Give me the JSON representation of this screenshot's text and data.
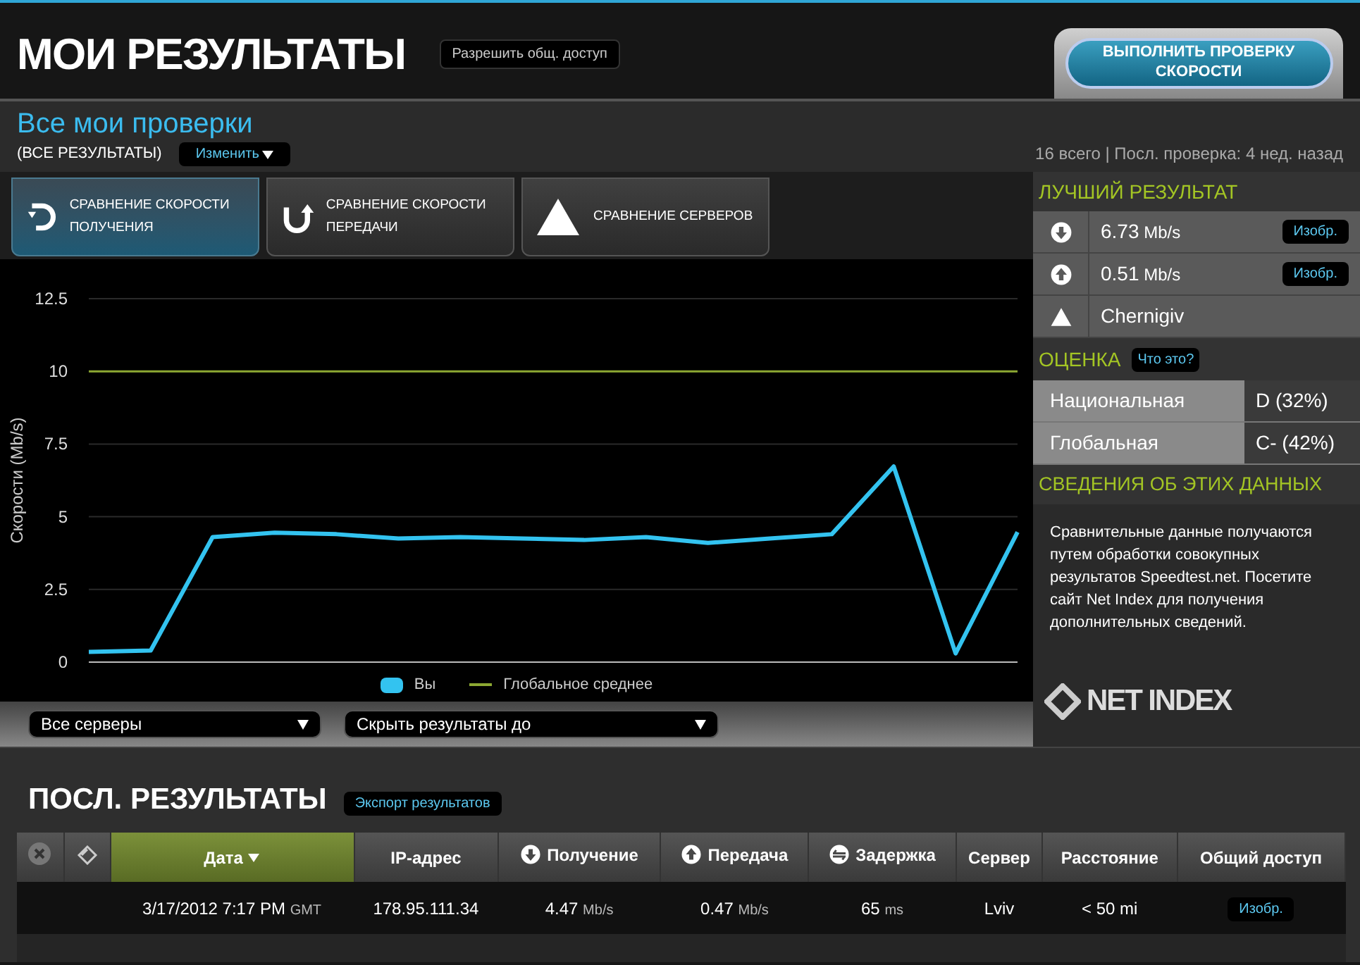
{
  "header": {
    "title": "МОИ РЕЗУЛЬТАТЫ",
    "share_button": "Разрешить общ. доступ",
    "run_test_button": "ВЫПОЛНИТЬ ПРОВЕРКУ СКОРОСТИ"
  },
  "overview": {
    "title": "Все мои проверки",
    "filter_label": "(ВСЕ РЕЗУЛЬТАТЫ)",
    "change_button": "Изменить",
    "summary": "16 всего | Посл. проверка: 4 нед. назад",
    "tabs": [
      {
        "kind": "download",
        "label": "СРАВНЕНИЕ СКОРОСТИ ПОЛУЧЕНИЯ",
        "selected": true
      },
      {
        "kind": "upload",
        "label": "СРАВНЕНИЕ СКОРОСТИ ПЕРЕДАЧИ",
        "selected": false
      },
      {
        "kind": "server",
        "label": "СРАВНЕНИЕ СЕРВЕРОВ",
        "selected": false
      }
    ],
    "chart_data": {
      "type": "line",
      "ylabel": "Скорости (Mb/s)",
      "grid": true,
      "ylim": [
        0,
        12.5
      ],
      "yticks": [
        0,
        2.5,
        5,
        7.5,
        10,
        12.5
      ],
      "series": [
        {
          "name": "Вы",
          "color": "#33c3f0",
          "values": [
            0.35,
            0.4,
            4.3,
            4.45,
            4.4,
            4.25,
            4.3,
            4.25,
            4.2,
            4.3,
            4.1,
            4.25,
            4.4,
            6.73,
            0.3,
            4.47
          ]
        },
        {
          "name": "Глобальное среднее",
          "color": "#8ca832",
          "values": [
            10,
            10,
            10,
            10,
            10,
            10,
            10,
            10,
            10,
            10,
            10,
            10,
            10,
            10,
            10,
            10
          ]
        }
      ]
    },
    "server_select": "Все серверы",
    "hide_select": "Скрыть результаты до"
  },
  "best": {
    "title": "ЛУЧШИЙ РЕЗУЛЬТАТ",
    "rows": [
      {
        "kind": "download",
        "value": "6.73",
        "unit": "Mb/s",
        "button": "Изобр."
      },
      {
        "kind": "upload",
        "value": "0.51",
        "unit": "Mb/s",
        "button": "Изобр."
      },
      {
        "kind": "server",
        "value": "Chernigiv"
      }
    ]
  },
  "grade": {
    "title": "ОЦЕНКА",
    "help_button": "Что это?",
    "rows": [
      {
        "label": "Национальная",
        "value": "D (32%)"
      },
      {
        "label": "Глобальная",
        "value": "C- (42%)"
      }
    ]
  },
  "about": {
    "title": "СВЕДЕНИЯ ОБ ЭТИХ ДАННЫХ",
    "text": "Сравнительные данные получаются путем обработки совокупных результатов Speedtest.net. Посетите сайт Net Index для получения дополнительных сведений.",
    "logo": "NET INDEX"
  },
  "recent": {
    "title": "ПОСЛ. РЕЗУЛЬТАТЫ",
    "export_button": "Экспорт результатов",
    "columns": [
      {
        "kind": "delete"
      },
      {
        "kind": "share"
      },
      {
        "kind": "text",
        "label": "Дата",
        "selected": true
      },
      {
        "kind": "text",
        "label": "IP-адрес",
        "selected": false
      },
      {
        "kind": "download",
        "label": "Получение",
        "selected": false
      },
      {
        "kind": "upload",
        "label": "Передача",
        "selected": false
      },
      {
        "kind": "ping",
        "label": "Задержка",
        "selected": false
      },
      {
        "kind": "text",
        "label": "Сервер",
        "selected": false
      },
      {
        "kind": "text",
        "label": "Расстояние",
        "selected": false
      },
      {
        "kind": "text",
        "label": "Общий доступ",
        "selected": false
      }
    ],
    "rows": [
      {
        "date": "3/17/2012 7:17 PM",
        "tz": "GMT",
        "ip": "178.95.111.34",
        "download": "4.47",
        "download_unit": "Mb/s",
        "upload": "0.47",
        "upload_unit": "Mb/s",
        "ping": "65",
        "ping_unit": "ms",
        "server": "Lviv",
        "distance": "< 50 mi",
        "button": "Изобр."
      }
    ]
  }
}
